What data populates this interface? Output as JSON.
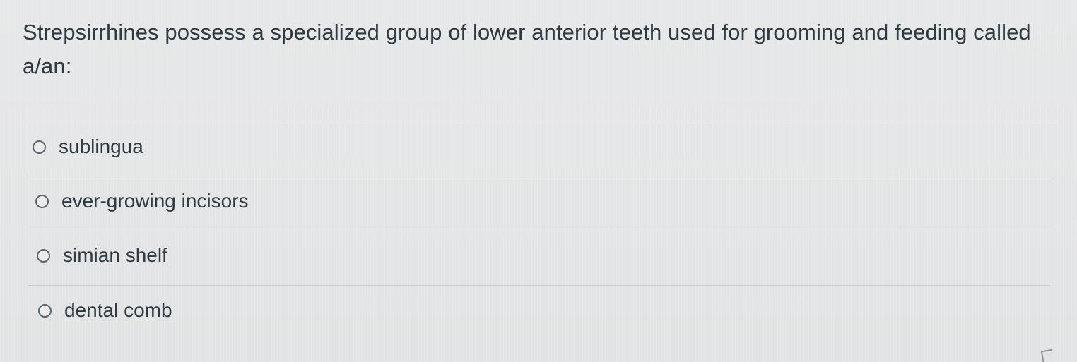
{
  "question": {
    "text": "Strepsirrhines possess a specialized group of lower anterior teeth used for grooming and feeding called a/an:"
  },
  "answers": [
    {
      "label": "sublingua",
      "selected": false
    },
    {
      "label": "ever-growing incisors",
      "selected": false
    },
    {
      "label": "simian shelf",
      "selected": false
    },
    {
      "label": "dental comb",
      "selected": false
    }
  ]
}
